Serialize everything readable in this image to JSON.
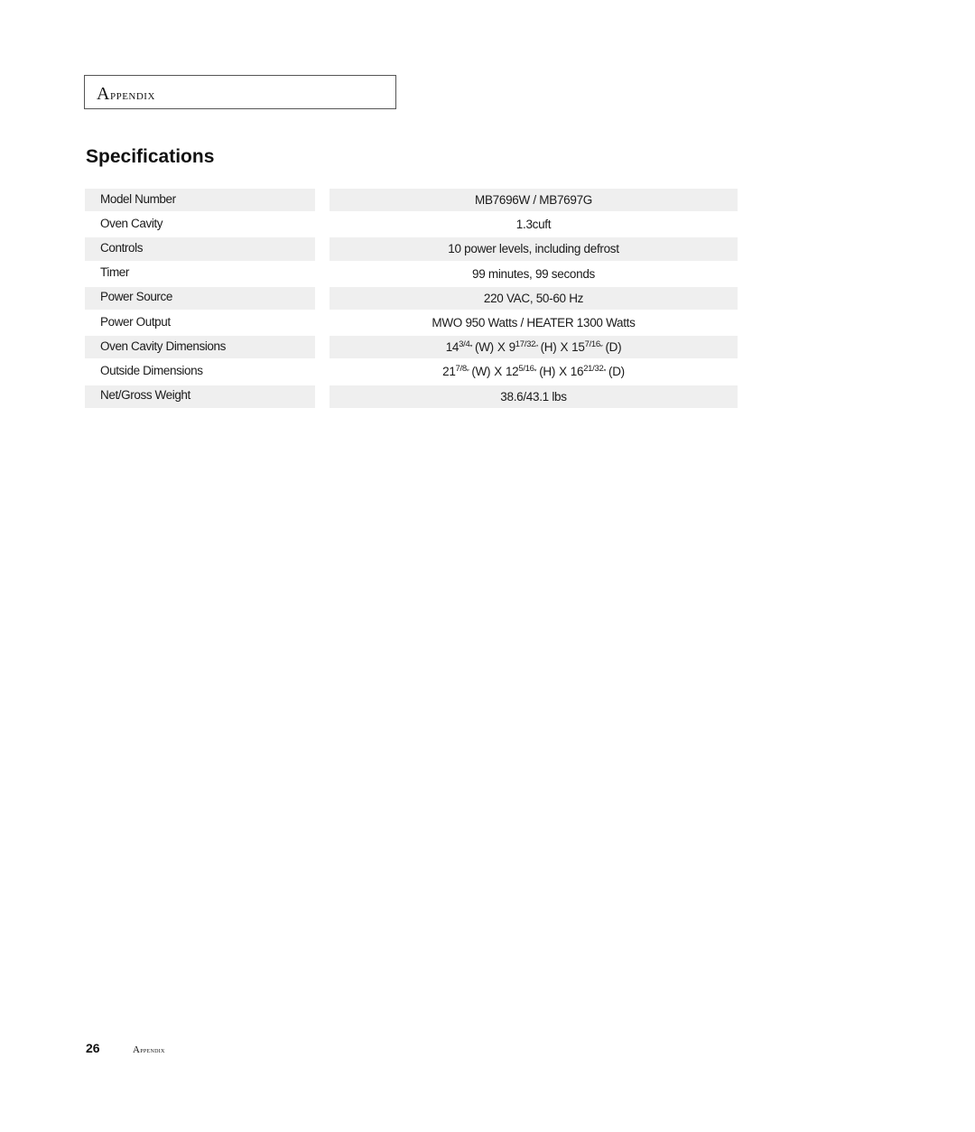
{
  "header": {
    "section_label": "Appendix"
  },
  "page_title": "Specifications",
  "specs": [
    {
      "label": "Model Number",
      "value": "MB7696W / MB7697G",
      "shaded": true
    },
    {
      "label": "Oven Cavity",
      "value": "1.3cuft",
      "shaded": false
    },
    {
      "label": "Controls",
      "value": "10 power levels, including defrost",
      "shaded": true
    },
    {
      "label": "Timer",
      "value": "99 minutes, 99 seconds",
      "shaded": false
    },
    {
      "label": "Power Source",
      "value": "220 VAC, 50-60 Hz",
      "shaded": true
    },
    {
      "label": "Power Output",
      "value": "MWO 950 Watts / HEATER 1300 Watts",
      "shaded": false
    },
    {
      "label": "Oven Cavity Dimensions",
      "shaded": true,
      "dims": [
        {
          "whole": "14",
          "frac": "3/4",
          "unit": "″",
          "axis": "(W)"
        },
        {
          "whole": "9",
          "frac": "17/32",
          "unit": "″",
          "axis": "(H)"
        },
        {
          "whole": "15",
          "frac": "7/16",
          "unit": "″",
          "axis": "(D)"
        }
      ]
    },
    {
      "label": "Outside Dimensions",
      "shaded": false,
      "dims": [
        {
          "whole": "21",
          "frac": "7/8",
          "unit": "″",
          "axis": "(W)"
        },
        {
          "whole": "12",
          "frac": "5/16",
          "unit": "″",
          "axis": "(H)"
        },
        {
          "whole": "16",
          "frac": "21/32",
          "unit": "″",
          "axis": "(D)"
        }
      ]
    },
    {
      "label": "Net/Gross Weight",
      "value": "38.6/43.1 lbs",
      "shaded": true
    }
  ],
  "dimension_separator": "X",
  "footer": {
    "page_number": "26",
    "section_label": "Appendix"
  }
}
